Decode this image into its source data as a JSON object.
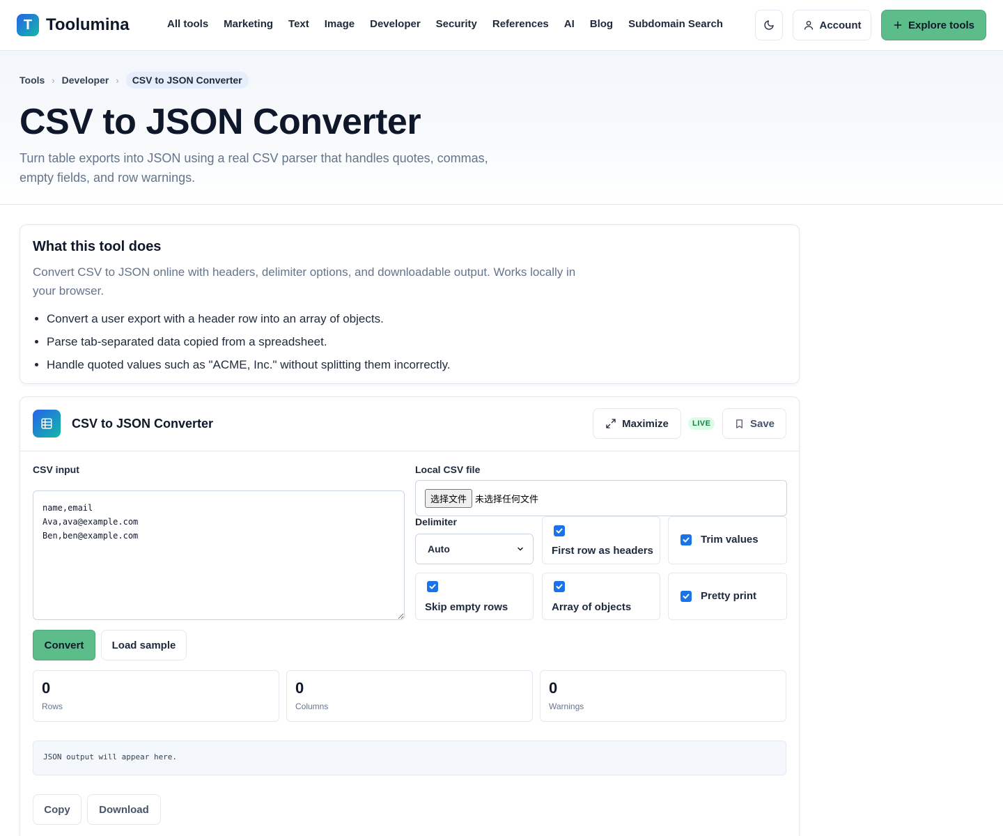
{
  "brand": {
    "logo_letter": "T",
    "name": "Toolumina"
  },
  "nav": {
    "items": [
      "All tools",
      "Marketing",
      "Text",
      "Image",
      "Developer",
      "Security",
      "References",
      "AI",
      "Blog",
      "Subdomain Search"
    ]
  },
  "header_actions": {
    "theme_icon": "moon-icon",
    "account_label": "Account",
    "explore_label": "Explore tools"
  },
  "breadcrumb": {
    "items": [
      "Tools",
      "Developer"
    ],
    "current": "CSV to JSON Converter"
  },
  "page": {
    "title": "CSV to JSON Converter",
    "description": "Turn table exports into JSON using a real CSV parser that handles quotes, commas, empty fields, and row warnings."
  },
  "about": {
    "title": "What this tool does",
    "description": "Convert CSV to JSON online with headers, delimiter options, and downloadable output. Works locally in your browser.",
    "bullets": [
      "Convert a user export with a header row into an array of objects.",
      "Parse tab-separated data copied from a spreadsheet.",
      "Handle quoted values such as \"ACME, Inc.\" without splitting them incorrectly."
    ]
  },
  "tool": {
    "title": "CSV to JSON Converter",
    "maximize_label": "Maximize",
    "live_badge": "LIVE",
    "save_label": "Save",
    "csv_input_label": "CSV input",
    "csv_input_value": "name,email\nAva,ava@example.com\nBen,ben@example.com",
    "file_label": "Local CSV file",
    "file_button": "选择文件",
    "file_status": "未选择任何文件",
    "delimiter_label": "Delimiter",
    "delimiter_value": "Auto",
    "options": {
      "first_row_headers": {
        "label": "First row as headers",
        "checked": true
      },
      "trim_values": {
        "label": "Trim values",
        "checked": true
      },
      "skip_empty_rows": {
        "label": "Skip empty rows",
        "checked": true
      },
      "array_of_objects": {
        "label": "Array of objects",
        "checked": true
      },
      "pretty_print": {
        "label": "Pretty print",
        "checked": true
      }
    },
    "convert_label": "Convert",
    "load_sample_label": "Load sample",
    "stats": {
      "rows": {
        "value": "0",
        "label": "Rows"
      },
      "columns": {
        "value": "0",
        "label": "Columns"
      },
      "warnings": {
        "value": "0",
        "label": "Warnings"
      }
    },
    "output_placeholder": "JSON output will appear here.",
    "copy_label": "Copy",
    "download_label": "Download"
  },
  "colors": {
    "accent_green": "#5cbd8a",
    "checkbox_blue": "#1a73e8",
    "live_badge_bg": "#dcfce7",
    "live_badge_text": "#15803d"
  }
}
